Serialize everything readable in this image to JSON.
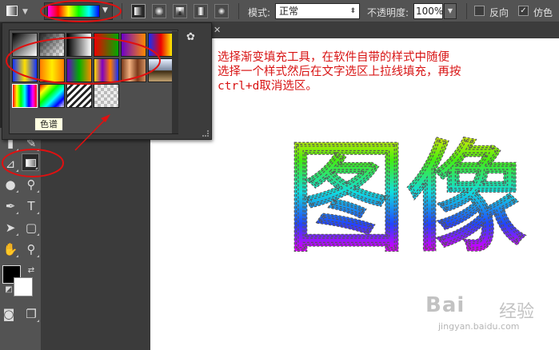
{
  "options_bar": {
    "mode_label": "模式:",
    "mode_value": "正常",
    "opacity_label": "不透明度:",
    "opacity_value": "100%",
    "reverse_label": "反向",
    "dither_label": "仿色",
    "reverse_checked": false,
    "dither_checked": true,
    "gradient_types": [
      "linear",
      "radial",
      "angle",
      "reflected",
      "diamond"
    ]
  },
  "gradient_picker": {
    "tooltip": "色谱",
    "settings_icon": "gear-icon",
    "presets": [
      [
        "foreground-to-background",
        "foreground-to-transparent",
        "black-white",
        "red-green",
        "violet-orange",
        "blue-red-yellow"
      ],
      [
        "blue-yellow-blue",
        "orange-yellow-orange",
        "violet-green-orange",
        "yellow-violet-orange-blue",
        "copper",
        "chrome"
      ],
      [
        "spectrum",
        "transparent-rainbow",
        "transparent-stripes",
        "transparent-checker",
        "",
        ""
      ]
    ]
  },
  "canvas": {
    "instruction_lines": [
      "选择渐变填充工具，在软件自带的样式中随便",
      "选择一个样式然后在文字选区上拉线填充，再按",
      "ctrl+d取消选区。"
    ],
    "big_text": "图像",
    "watermark": "Bai",
    "watermark_cn": "经验",
    "watermark_sub": "jingyan.baidu.com"
  },
  "toolbar": {
    "tools": [
      "brush-icon",
      "gradient-tool-icon",
      "blur-drop-icon",
      "dodge-icon",
      "pen-icon",
      "type-icon",
      "path-select-icon",
      "shape-icon",
      "hand-icon",
      "zoom-icon",
      "quick-mask-icon",
      "screen-mode-icon"
    ],
    "selected_tool": "gradient-tool-icon",
    "foreground_color": "#000000",
    "background_color": "#ffffff"
  },
  "colors": {
    "annotation_red": "#e01010",
    "instruction_red": "#d81414"
  }
}
